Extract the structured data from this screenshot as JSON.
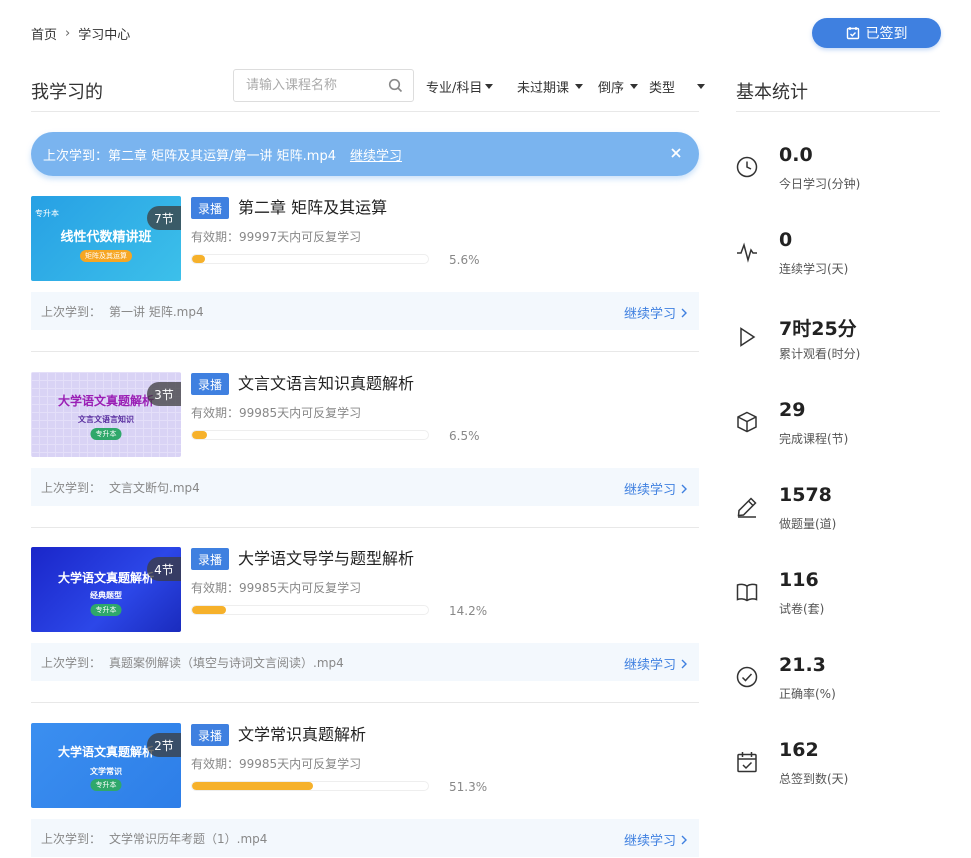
{
  "breadcrumb": {
    "home": "首页",
    "separator": "›",
    "current": "学习中心"
  },
  "signin": {
    "label": "已签到",
    "color": "#3f80e0"
  },
  "left": {
    "title": "我学习的",
    "search_placeholder": "请输入课程名称",
    "filters": [
      "专业/科目",
      "未过期课",
      "倒序",
      "类型"
    ]
  },
  "last_learned": {
    "text": "上次学到：第二章 矩阵及其运算/第一讲 矩阵.mp4",
    "continue_label": "继续学习"
  },
  "courses": [
    {
      "tag": "录播",
      "title": "第二章 矩阵及其运算",
      "validity": "有效期：99997天内可反复学习",
      "progress": 5.6,
      "percent": "5.6%",
      "sections": "7节",
      "thumb_corner": "专升本",
      "thumb_title": "线性代数精讲班",
      "thumb_pill": "矩阵及其运算",
      "last_label": "上次学到：",
      "last_item": "第一讲 矩阵.mp4",
      "continue": "继续学习"
    },
    {
      "tag": "录播",
      "title": "文言文语言知识真题解析",
      "validity": "有效期：99985天内可反复学习",
      "progress": 6.5,
      "percent": "6.5%",
      "sections": "3节",
      "thumb_title": "大学语文真题解析",
      "thumb_sub": "文言文语言知识",
      "thumb_pill": "专升本",
      "last_label": "上次学到：",
      "last_item": "文言文断句.mp4",
      "continue": "继续学习"
    },
    {
      "tag": "录播",
      "title": "大学语文导学与题型解析",
      "validity": "有效期：99985天内可反复学习",
      "progress": 14.2,
      "percent": "14.2%",
      "sections": "4节",
      "thumb_title": "大学语文真题解析",
      "thumb_sub": "经典题型",
      "thumb_pill": "专升本",
      "last_label": "上次学到：",
      "last_item": "真题案例解读（填空与诗词文言阅读）.mp4",
      "continue": "继续学习"
    },
    {
      "tag": "录播",
      "title": "文学常识真题解析",
      "validity": "有效期：99985天内可反复学习",
      "progress": 51.3,
      "percent": "51.3%",
      "sections": "2节",
      "thumb_title": "大学语文真题解析",
      "thumb_sub": "文学常识",
      "thumb_pill": "专升本",
      "last_label": "上次学到：",
      "last_item": "文学常识历年考题（1）.mp4",
      "continue": "继续学习"
    }
  ],
  "stats": {
    "title": "基本统计",
    "items": [
      {
        "value": "0.0",
        "label": "今日学习(分钟)",
        "icon": "clock-icon"
      },
      {
        "value": "0",
        "label": "连续学习(天)",
        "icon": "pulse-icon"
      },
      {
        "value": "7时25分",
        "label": "累计观看(时分)",
        "icon": "play-icon"
      },
      {
        "value": "29",
        "label": "完成课程(节)",
        "icon": "cube-icon"
      },
      {
        "value": "1578",
        "label": "做题量(道)",
        "icon": "pencil-icon"
      },
      {
        "value": "116",
        "label": "试卷(套)",
        "icon": "book-icon"
      },
      {
        "value": "21.3",
        "label": "正确率(%)",
        "icon": "check-circle-icon"
      },
      {
        "value": "162",
        "label": "总签到数(天)",
        "icon": "calendar-check-icon"
      }
    ]
  },
  "colors": {
    "accent": "#3f80e0",
    "progress": "#f6b12b",
    "banner": "#7ab4ef"
  }
}
